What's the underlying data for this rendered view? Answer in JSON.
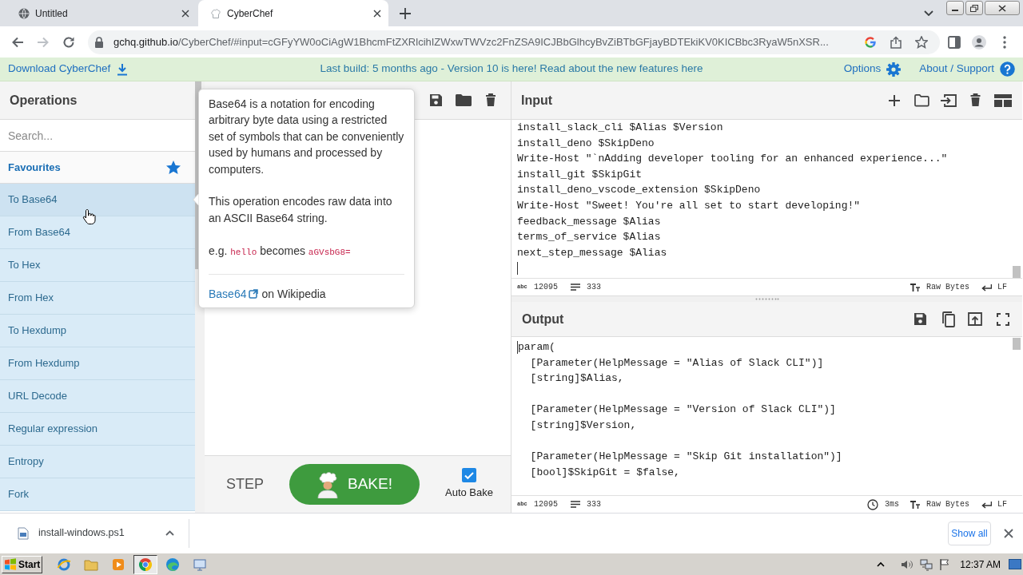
{
  "browser": {
    "tabs": [
      {
        "title": "Untitled",
        "selected": false
      },
      {
        "title": "CyberChef",
        "selected": true
      }
    ],
    "address": {
      "host": "gchq.github.io",
      "path": "/CyberChef/#input=cGFyYW0oCiAgW1BhcmFtZXRlcihIZWxwTWVzc2FnZSA9ICJBbGlhcyBvZiBTbGFjayBDTEkiKV0KICBbc3RyaW5nXSR..."
    }
  },
  "banner": {
    "download": "Download CyberChef",
    "notice": "Last build: 5 months ago - Version 10 is here! Read about the new features here",
    "options": "Options",
    "about": "About / Support"
  },
  "operations": {
    "title": "Operations",
    "search": {
      "placeholder": "Search..."
    },
    "favourites": "Favourites",
    "items": [
      {
        "label": "To Base64",
        "hovered": true
      },
      {
        "label": "From Base64",
        "hovered": false
      },
      {
        "label": "To Hex",
        "hovered": false
      },
      {
        "label": "From Hex",
        "hovered": false
      },
      {
        "label": "To Hexdump",
        "hovered": false
      },
      {
        "label": "From Hexdump",
        "hovered": false
      },
      {
        "label": "URL Decode",
        "hovered": false
      },
      {
        "label": "Regular expression",
        "hovered": false
      },
      {
        "label": "Entropy",
        "hovered": false
      },
      {
        "label": "Fork",
        "hovered": false
      }
    ]
  },
  "tooltip": {
    "description": "Base64 is a notation for encoding arbitrary byte data using a restricted set of symbols that can be conveniently used by humans and processed by computers.",
    "detail": "This operation encodes raw data into an ASCII Base64 string.",
    "example": [
      {
        "kind": "text",
        "text": "e.g."
      },
      {
        "kind": "code",
        "text": "hello"
      },
      {
        "kind": "text",
        "text": "becomes"
      },
      {
        "kind": "code",
        "text": "aGVsbG8="
      }
    ],
    "link": "Base64",
    "link_suffix": "on Wikipedia"
  },
  "recipe": {
    "step": "STEP",
    "bake": "BAKE!",
    "auto_bake": {
      "label": "Auto Bake",
      "checked": true
    }
  },
  "input": {
    "title": "Input",
    "text": "install_slack_cli $Alias $Version\ninstall_deno $SkipDeno\nWrite-Host \"`nAdding developer tooling for an enhanced experience...\"\ninstall_git $SkipGit\ninstall_deno_vscode_extension $SkipDeno\nWrite-Host \"Sweet! You're all set to start developing!\"\nfeedback_message $Alias\nterms_of_service $Alias\nnext_step_message $Alias",
    "status": {
      "length_label": "abc",
      "length": "12095",
      "lines": "333",
      "encoding": "Raw Bytes",
      "eol": "LF"
    }
  },
  "output": {
    "title": "Output",
    "text": "param(\n  [Parameter(HelpMessage = \"Alias of Slack CLI\")]\n  [string]$Alias,\n\n  [Parameter(HelpMessage = \"Version of Slack CLI\")]\n  [string]$Version,\n\n  [Parameter(HelpMessage = \"Skip Git installation\")]\n  [bool]$SkipGit = $false,",
    "status": {
      "length_label": "abc",
      "length": "12095",
      "lines": "333",
      "time": "3ms",
      "encoding": "Raw Bytes",
      "eol": "LF"
    }
  },
  "download_bar": {
    "file": "install-windows.ps1",
    "show_all": "Show all"
  },
  "taskbar": {
    "start": "Start",
    "apps": [
      {
        "kind": "ring",
        "selected": false
      },
      {
        "kind": "folder",
        "selected": false
      },
      {
        "kind": "player",
        "selected": false
      },
      {
        "kind": "browser",
        "selected": true
      },
      {
        "kind": "wave",
        "selected": false
      },
      {
        "kind": "monitor",
        "selected": false
      }
    ],
    "clock": "12:37 AM"
  }
}
